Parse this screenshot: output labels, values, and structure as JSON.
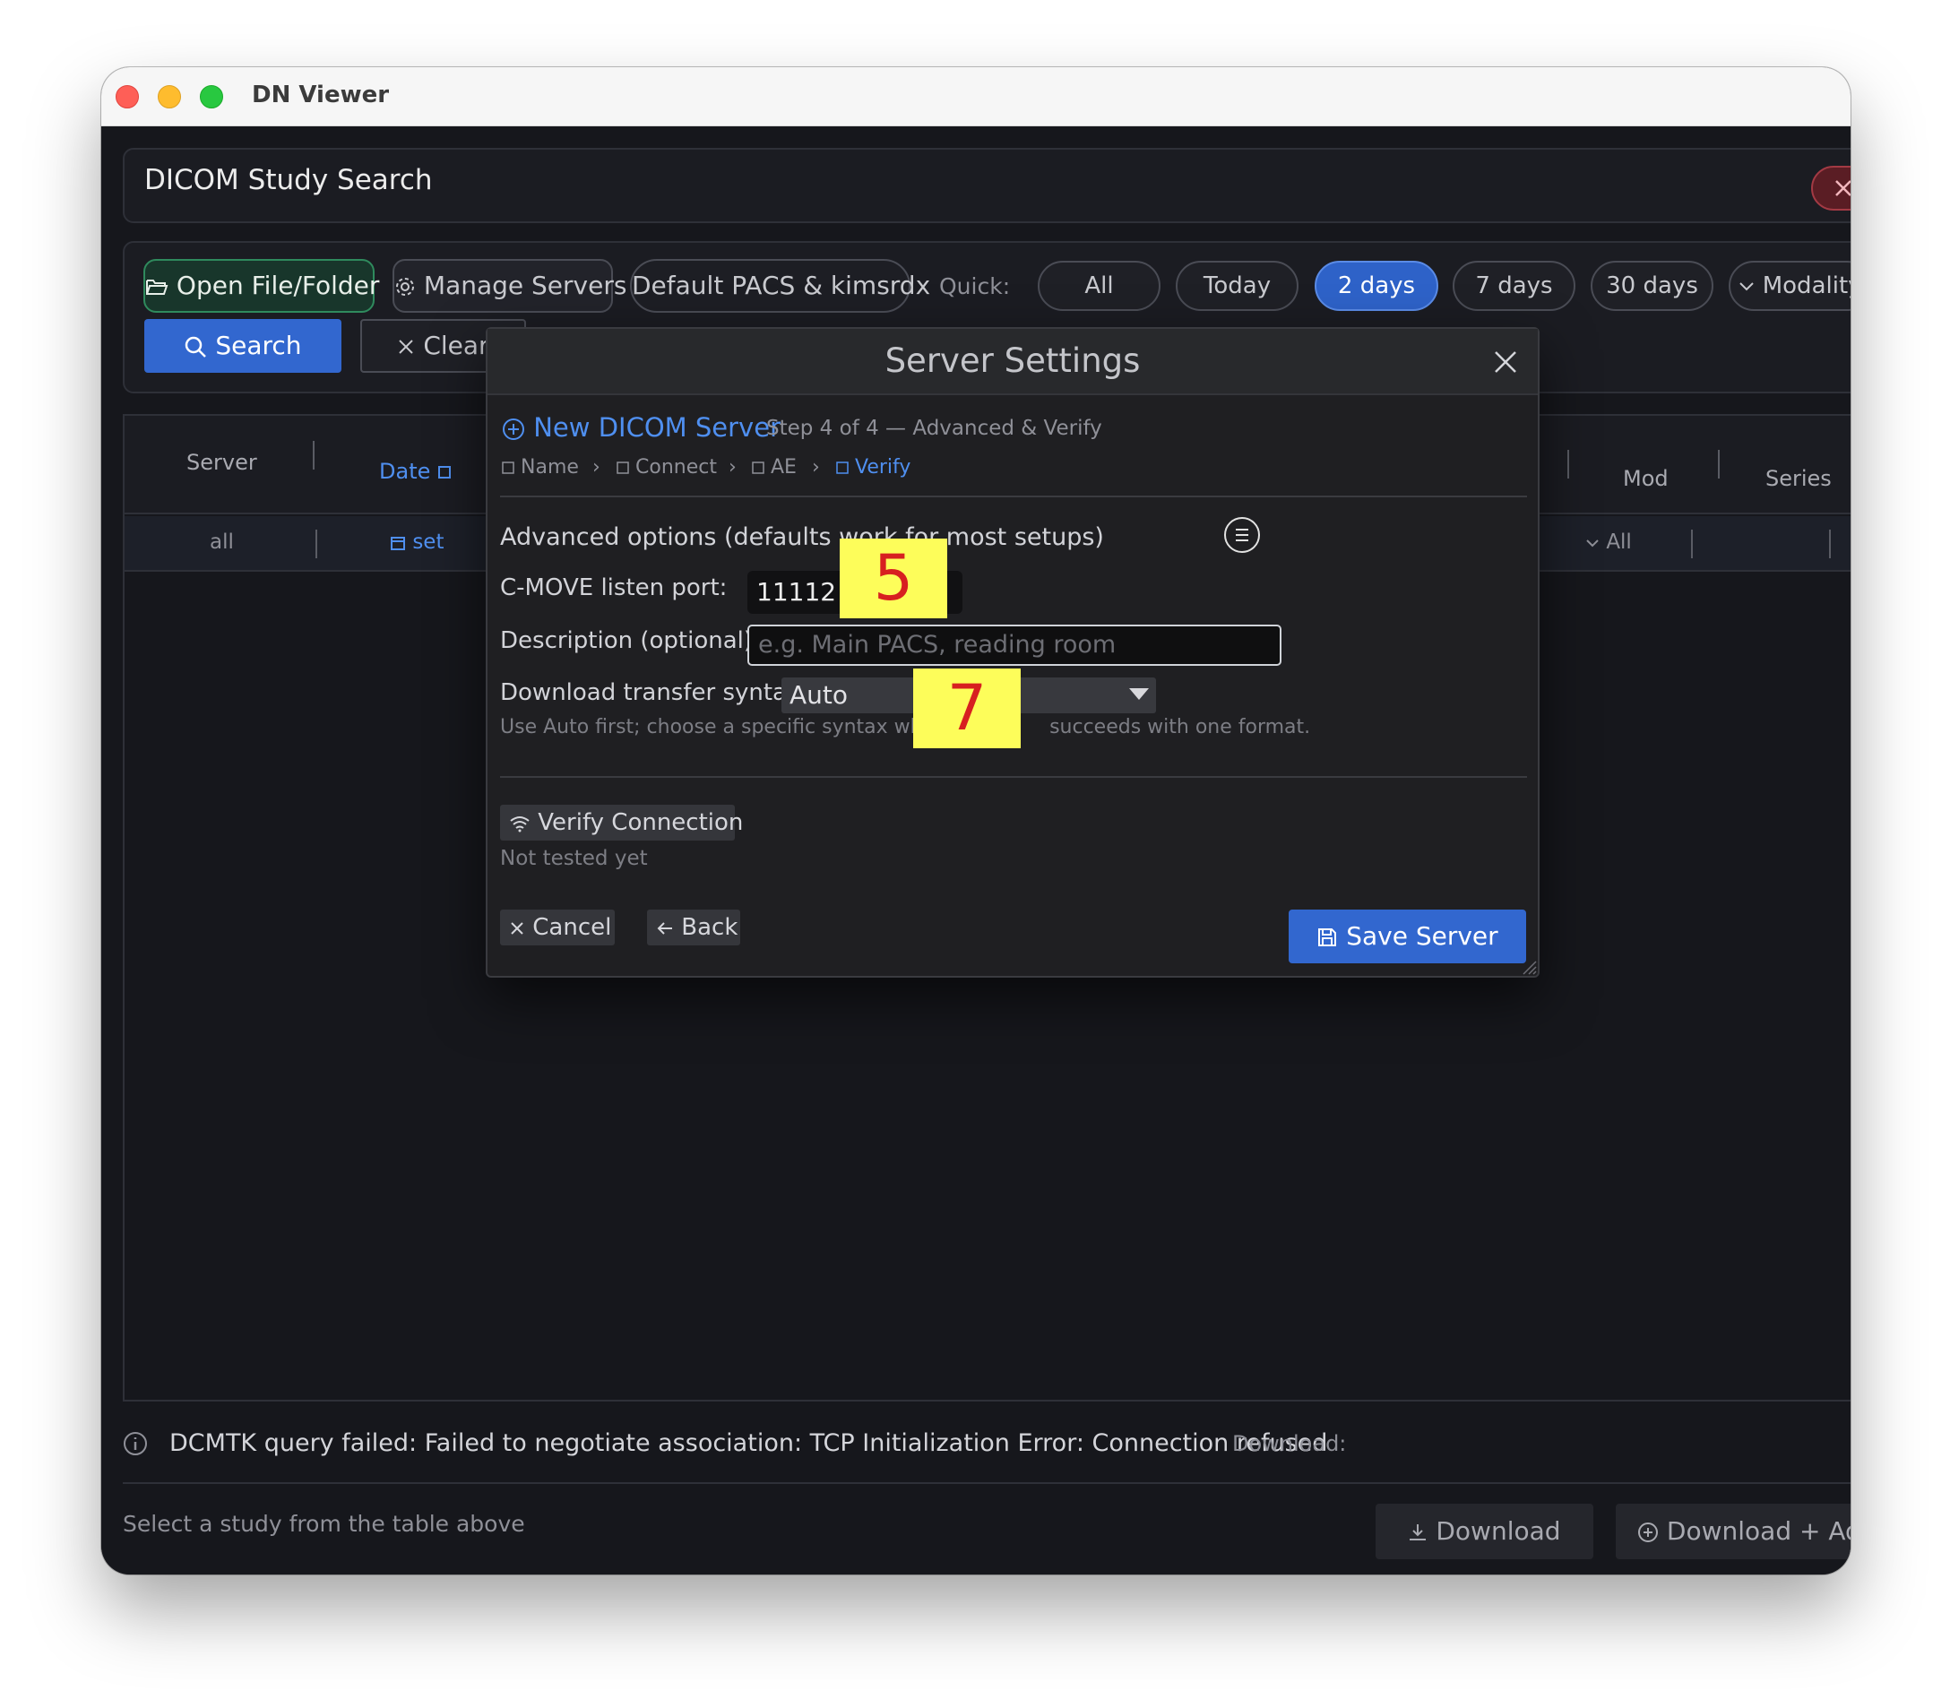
{
  "window": {
    "title": "DN Viewer"
  },
  "header": {
    "title": "DICOM Study Search",
    "close_icon": "close-icon"
  },
  "toolbar": {
    "open_label": "Open File/Folder",
    "manage_label": "Manage Servers",
    "default_server_label": "Default PACS & kimsrdx",
    "quick_label": "Quick:",
    "quick_options": [
      "All",
      "Today",
      "2 days",
      "7 days",
      "30 days"
    ],
    "quick_selected": "2 days",
    "modality_label": "Modality",
    "search_label": "Search",
    "clear_label": "Clear"
  },
  "table": {
    "headers": {
      "server": "Server",
      "date": "Date",
      "mod": "Mod",
      "series": "Series"
    },
    "filters": {
      "server": "all",
      "date": "set",
      "mod": "All"
    }
  },
  "status": {
    "message": "DCMTK query failed: Failed to negotiate association: TCP Initialization Error: Connection refused",
    "download_label": "Download:",
    "hint": "Select a study from the table above",
    "download_button": "Download",
    "download_add_button": "Download + Add"
  },
  "dialog": {
    "title": "Server Settings",
    "new_server_label": "New DICOM Server",
    "step_text": "Step 4 of 4 — Advanced & Verify",
    "breadcrumbs": [
      "Name",
      "Connect",
      "AE",
      "Verify"
    ],
    "active_step": "Verify",
    "advanced_label": "Advanced options (defaults work for most setups)",
    "port_label": "C-MOVE listen port:",
    "port_value": "11112",
    "description_label": "Description (optional):",
    "description_placeholder": "e.g. Main PACS, reading room",
    "syntax_label": "Download transfer syntax:",
    "syntax_value": "Auto",
    "syntax_hint_left": "Use Auto first; choose a specific syntax when",
    "syntax_hint_right": "succeeds with one format.",
    "verify_label": "Verify Connection",
    "verify_status": "Not tested yet",
    "cancel_label": "Cancel",
    "back_label": "Back",
    "save_label": "Save Server"
  },
  "annotations": {
    "badge_a": "5",
    "badge_b": "7"
  },
  "colors": {
    "accent": "#3267cf",
    "link": "#4f8ff0",
    "danger": "#fe5f57",
    "badge_bg": "#fdfd5a",
    "badge_text": "#d72020"
  }
}
